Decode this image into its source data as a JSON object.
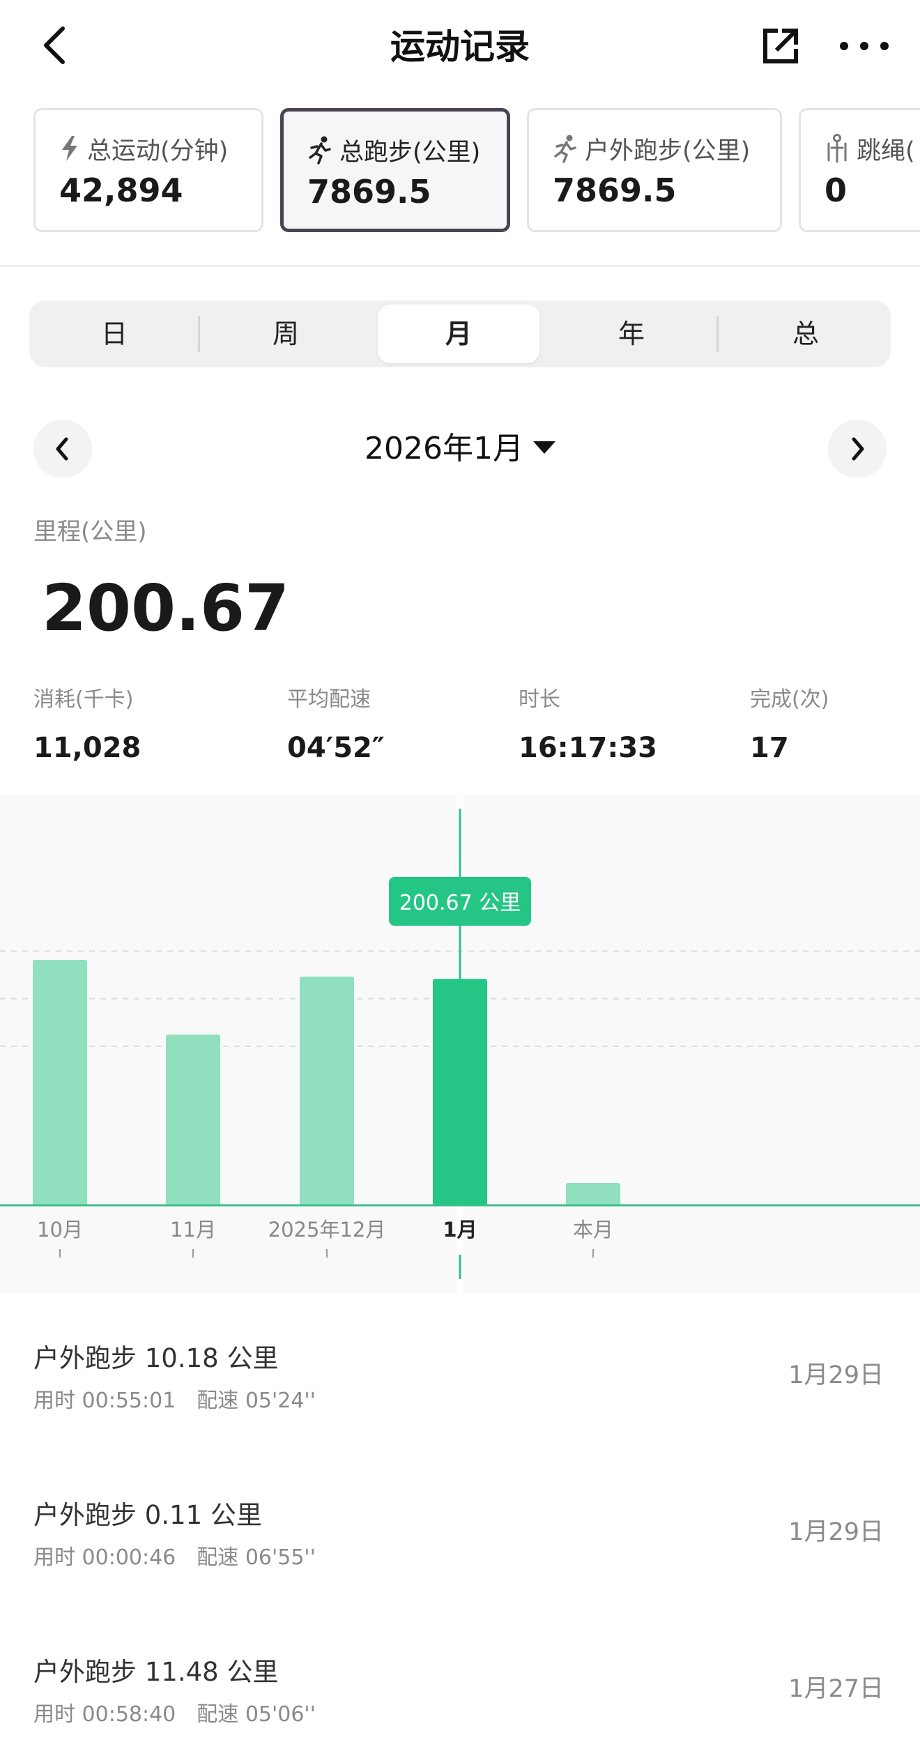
{
  "header": {
    "title": "运动记录"
  },
  "cards": [
    {
      "label": "总运动(分钟)",
      "value": "42,894",
      "icon": "lightning-icon",
      "active": false
    },
    {
      "label": "总跑步(公里)",
      "value": "7869.5",
      "icon": "runner-icon",
      "active": true
    },
    {
      "label": "户外跑步(公里)",
      "value": "7869.5",
      "icon": "runner-icon",
      "active": false
    },
    {
      "label": "跳绳(",
      "value": "0",
      "icon": "jump-rope-icon",
      "active": false
    }
  ],
  "tabs": [
    "日",
    "周",
    "月",
    "年",
    "总"
  ],
  "selected_tab": "月",
  "period": {
    "label": "2026年1月"
  },
  "summary": {
    "distance_label": "里程(公里)",
    "distance_value": "200.67",
    "metrics": [
      {
        "label": "消耗(千卡)",
        "value": "11,028"
      },
      {
        "label": "平均配速",
        "value": "04′52″"
      },
      {
        "label": "时长",
        "value": "16:17:33"
      },
      {
        "label": "完成(次)",
        "value": "17"
      }
    ]
  },
  "chart_data": {
    "type": "bar",
    "categories": [
      "10月",
      "11月",
      "2025年12月",
      "1月",
      "本月"
    ],
    "values": [
      220,
      153,
      205,
      203,
      20
    ],
    "highlight_index": 3,
    "tooltip": "200.67 公里",
    "ylim": [
      0,
      300
    ],
    "grid": true,
    "colors": {
      "bar": "#90e0bf",
      "highlight": "#25c585",
      "axis": "#3fbf8a",
      "tooltip": "#25c585"
    }
  },
  "activities": [
    {
      "title": "户外跑步 10.18 公里",
      "time": "用时 00:55:01",
      "pace": "配速 05'24''",
      "date": "1月29日"
    },
    {
      "title": "户外跑步 0.11 公里",
      "time": "用时 00:00:46",
      "pace": "配速 06'55''",
      "date": "1月29日"
    },
    {
      "title": "户外跑步 11.48 公里",
      "time": "用时 00:58:40",
      "pace": "配速 05'06''",
      "date": "1月27日"
    }
  ]
}
